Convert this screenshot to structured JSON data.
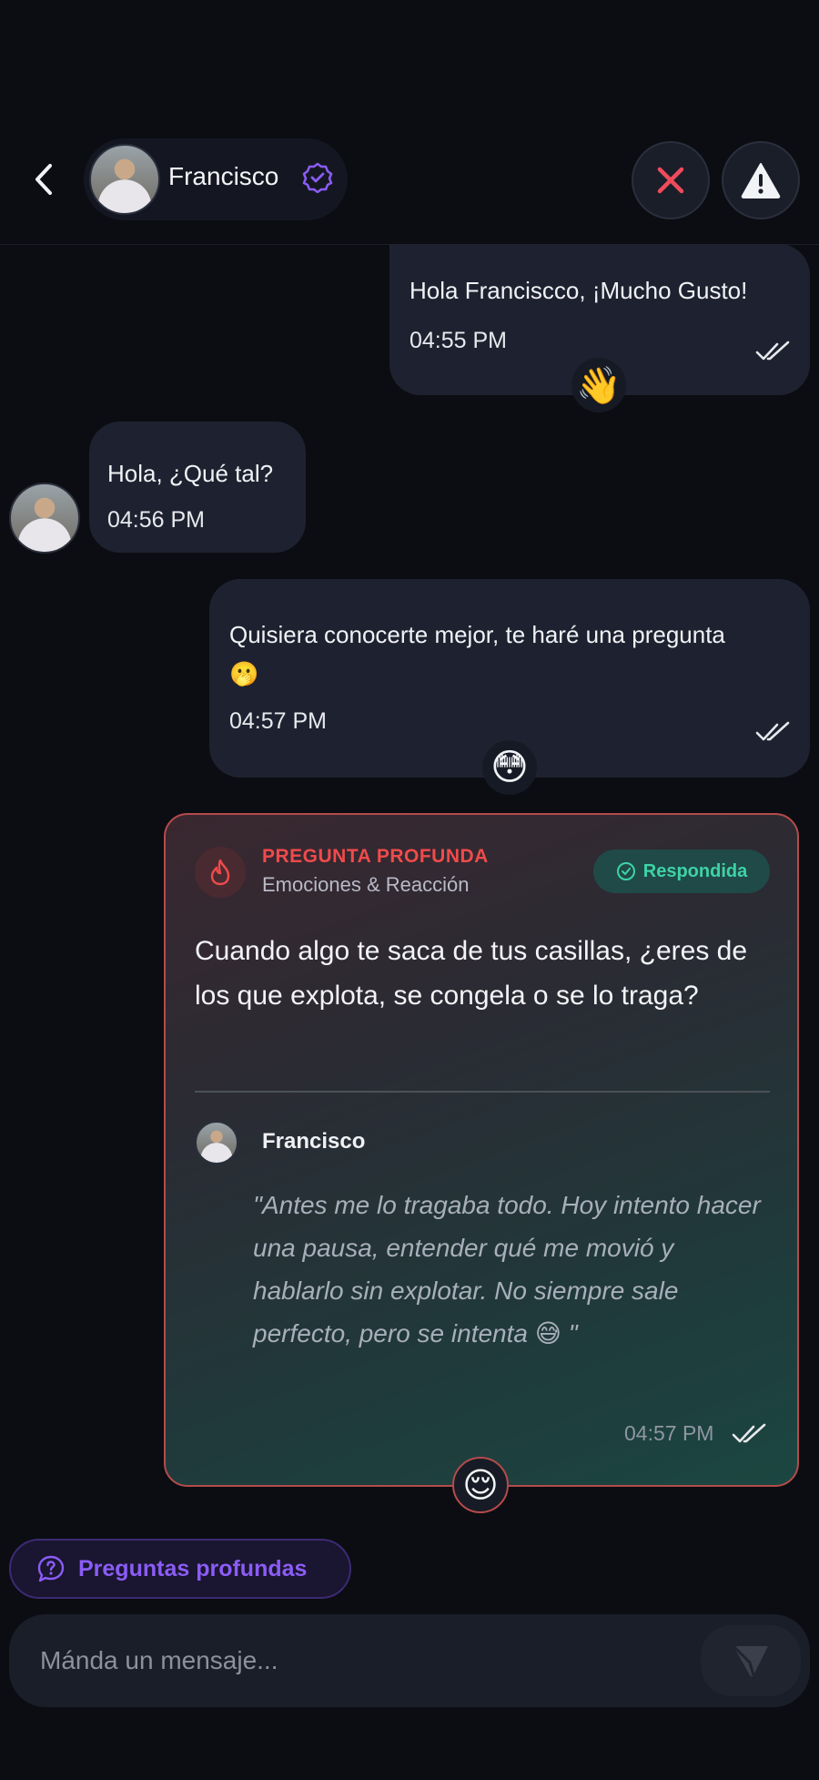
{
  "header": {
    "contact_name": "Francisco",
    "back_icon": "chevron-left-icon",
    "verified_icon": "verified-badge-icon",
    "close_icon": "close-x-icon",
    "report_icon": "warning-triangle-icon",
    "accent_verified": "#8b5cf6",
    "accent_close": "#ef4b5b"
  },
  "messages": [
    {
      "direction": "out",
      "text": "Hola Franciscco, ¡Mucho Gusto!",
      "time": "04:55 PM",
      "reaction": "👋"
    },
    {
      "direction": "in",
      "text": "Hola, ¿Qué tal?",
      "time": "04:56 PM"
    },
    {
      "direction": "out",
      "text": "Quisiera conocerte mejor, te haré una pregunta 🫢",
      "time": "04:57 PM",
      "reaction": "😳"
    }
  ],
  "question_card": {
    "type_label": "PREGUNTA PROFUNDA",
    "category": "Emociones & Reacción",
    "status": "Respondida",
    "question": "Cuando algo te saca de tus casillas, ¿eres de los que explota, se congela o se lo traga?",
    "answer_author": "Francisco",
    "answer": "\"Antes me lo tragaba todo. Hoy intento hacer una pausa, entender qué me movió y hablarlo sin explotar. No siempre sale perfecto, pero se intenta 😅 \"",
    "time": "04:57 PM",
    "reaction": "😌",
    "colors": {
      "type": "#ef4b4b",
      "status": "#3ed3a7",
      "border": "#b54b4b"
    }
  },
  "footer": {
    "deep_questions_label": "Preguntas profundas",
    "composer_placeholder": "Mánda un mensaje...",
    "send_icon": "send-icon",
    "accent": "#8b5cf6"
  }
}
